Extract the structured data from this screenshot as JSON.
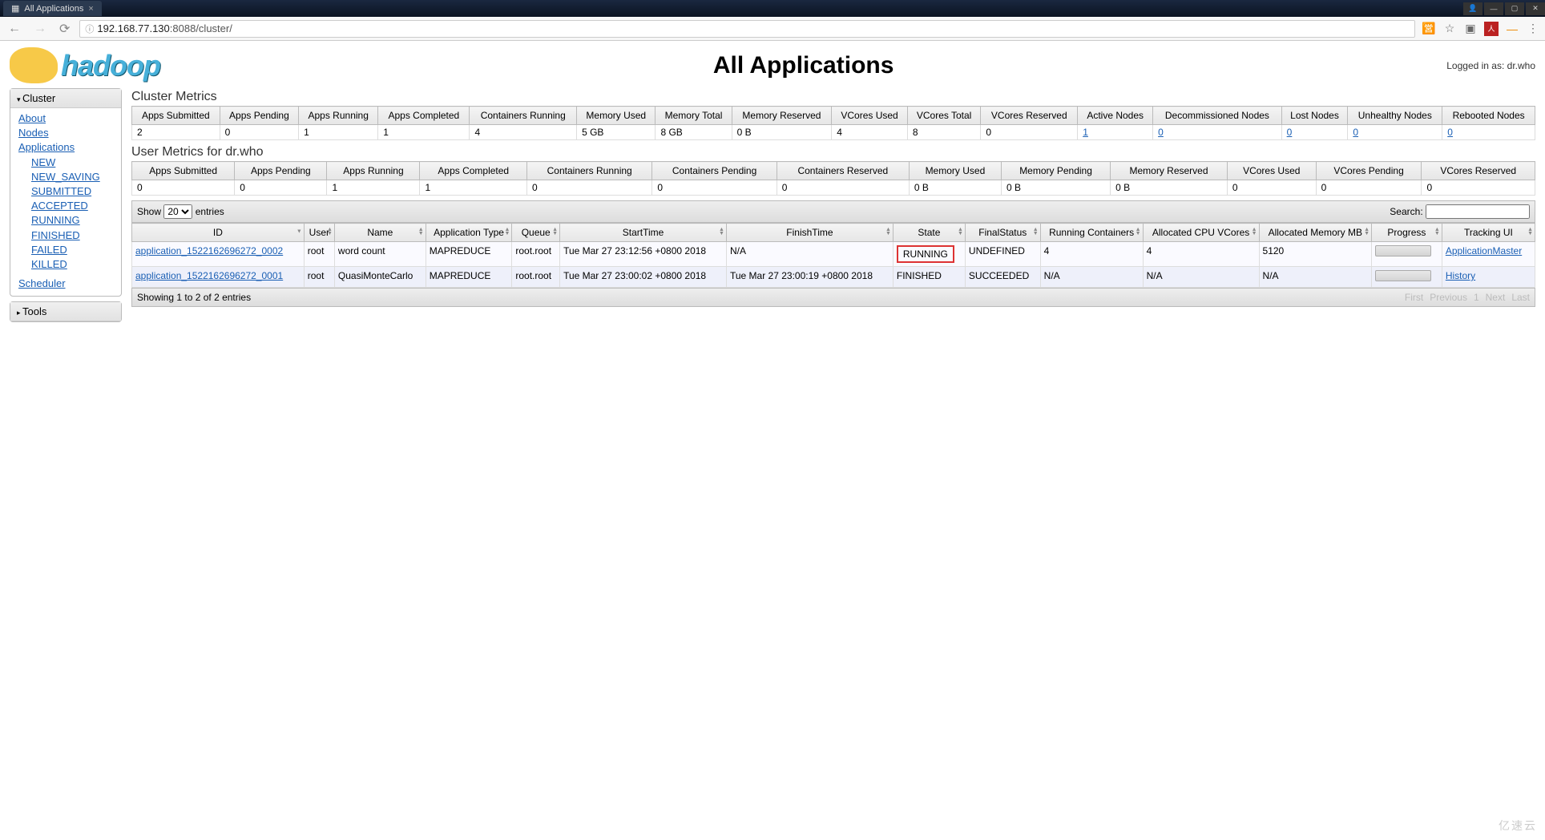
{
  "browser": {
    "tab_title": "All Applications",
    "url_full": "192.168.77.130:8088/cluster/",
    "url_host": "192.168.77.130",
    "url_port_path": ":8088/cluster/"
  },
  "header": {
    "logo_text": "hadoop",
    "page_title": "All Applications",
    "login_text": "Logged in as: dr.who"
  },
  "sidebar": {
    "cluster_label": "Cluster",
    "tools_label": "Tools",
    "links": {
      "about": "About",
      "nodes": "Nodes",
      "applications": "Applications",
      "scheduler": "Scheduler"
    },
    "app_states": [
      "NEW",
      "NEW_SAVING",
      "SUBMITTED",
      "ACCEPTED",
      "RUNNING",
      "FINISHED",
      "FAILED",
      "KILLED"
    ]
  },
  "cluster_metrics": {
    "title": "Cluster Metrics",
    "headers": [
      "Apps Submitted",
      "Apps Pending",
      "Apps Running",
      "Apps Completed",
      "Containers Running",
      "Memory Used",
      "Memory Total",
      "Memory Reserved",
      "VCores Used",
      "VCores Total",
      "VCores Reserved",
      "Active Nodes",
      "Decommissioned Nodes",
      "Lost Nodes",
      "Unhealthy Nodes",
      "Rebooted Nodes"
    ],
    "values": [
      "2",
      "0",
      "1",
      "1",
      "4",
      "5 GB",
      "8 GB",
      "0 B",
      "4",
      "8",
      "0",
      "1",
      "0",
      "0",
      "0",
      "0"
    ],
    "link_cols": [
      11,
      12,
      13,
      14,
      15
    ]
  },
  "user_metrics": {
    "title": "User Metrics for dr.who",
    "headers": [
      "Apps Submitted",
      "Apps Pending",
      "Apps Running",
      "Apps Completed",
      "Containers Running",
      "Containers Pending",
      "Containers Reserved",
      "Memory Used",
      "Memory Pending",
      "Memory Reserved",
      "VCores Used",
      "VCores Pending",
      "VCores Reserved"
    ],
    "values": [
      "0",
      "0",
      "1",
      "1",
      "0",
      "0",
      "0",
      "0 B",
      "0 B",
      "0 B",
      "0",
      "0",
      "0"
    ]
  },
  "datatable": {
    "show_label": "Show",
    "page_size": "20",
    "entries_label": "entries",
    "search_label": "Search:",
    "headers": [
      "ID",
      "User",
      "Name",
      "Application Type",
      "Queue",
      "StartTime",
      "FinishTime",
      "State",
      "FinalStatus",
      "Running Containers",
      "Allocated CPU VCores",
      "Allocated Memory MB",
      "Progress",
      "Tracking UI"
    ],
    "rows": [
      {
        "id": "application_1522162696272_0002",
        "user": "root",
        "name": "word count",
        "type": "MAPREDUCE",
        "queue": "root.root",
        "start": "Tue Mar 27 23:12:56 +0800 2018",
        "finish": "N/A",
        "state": "RUNNING",
        "running_highlight": true,
        "final": "UNDEFINED",
        "containers": "4",
        "vcores": "4",
        "memory": "5120",
        "tracking": "ApplicationMaster"
      },
      {
        "id": "application_1522162696272_0001",
        "user": "root",
        "name": "QuasiMonteCarlo",
        "type": "MAPREDUCE",
        "queue": "root.root",
        "start": "Tue Mar 27 23:00:02 +0800 2018",
        "finish": "Tue Mar 27 23:00:19 +0800 2018",
        "state": "FINISHED",
        "running_highlight": false,
        "final": "SUCCEEDED",
        "containers": "N/A",
        "vcores": "N/A",
        "memory": "N/A",
        "tracking": "History"
      }
    ],
    "footer_text": "Showing 1 to 2 of 2 entries",
    "pager": [
      "First",
      "Previous",
      "1",
      "Next",
      "Last"
    ]
  },
  "watermark": "亿速云"
}
